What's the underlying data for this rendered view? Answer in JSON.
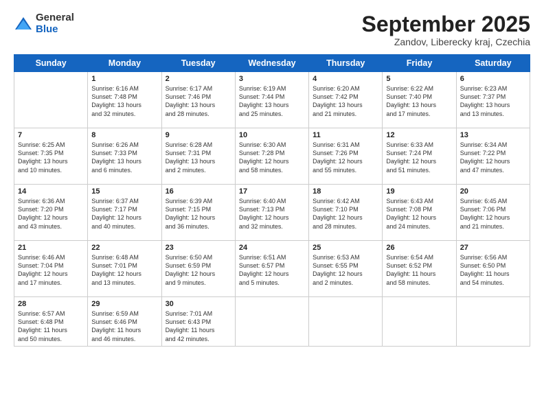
{
  "logo": {
    "general": "General",
    "blue": "Blue"
  },
  "header": {
    "month": "September 2025",
    "location": "Zandov, Liberecky kraj, Czechia"
  },
  "days_of_week": [
    "Sunday",
    "Monday",
    "Tuesday",
    "Wednesday",
    "Thursday",
    "Friday",
    "Saturday"
  ],
  "weeks": [
    [
      {
        "day": "",
        "info": ""
      },
      {
        "day": "1",
        "info": "Sunrise: 6:16 AM\nSunset: 7:48 PM\nDaylight: 13 hours\nand 32 minutes."
      },
      {
        "day": "2",
        "info": "Sunrise: 6:17 AM\nSunset: 7:46 PM\nDaylight: 13 hours\nand 28 minutes."
      },
      {
        "day": "3",
        "info": "Sunrise: 6:19 AM\nSunset: 7:44 PM\nDaylight: 13 hours\nand 25 minutes."
      },
      {
        "day": "4",
        "info": "Sunrise: 6:20 AM\nSunset: 7:42 PM\nDaylight: 13 hours\nand 21 minutes."
      },
      {
        "day": "5",
        "info": "Sunrise: 6:22 AM\nSunset: 7:40 PM\nDaylight: 13 hours\nand 17 minutes."
      },
      {
        "day": "6",
        "info": "Sunrise: 6:23 AM\nSunset: 7:37 PM\nDaylight: 13 hours\nand 13 minutes."
      }
    ],
    [
      {
        "day": "7",
        "info": "Sunrise: 6:25 AM\nSunset: 7:35 PM\nDaylight: 13 hours\nand 10 minutes."
      },
      {
        "day": "8",
        "info": "Sunrise: 6:26 AM\nSunset: 7:33 PM\nDaylight: 13 hours\nand 6 minutes."
      },
      {
        "day": "9",
        "info": "Sunrise: 6:28 AM\nSunset: 7:31 PM\nDaylight: 13 hours\nand 2 minutes."
      },
      {
        "day": "10",
        "info": "Sunrise: 6:30 AM\nSunset: 7:28 PM\nDaylight: 12 hours\nand 58 minutes."
      },
      {
        "day": "11",
        "info": "Sunrise: 6:31 AM\nSunset: 7:26 PM\nDaylight: 12 hours\nand 55 minutes."
      },
      {
        "day": "12",
        "info": "Sunrise: 6:33 AM\nSunset: 7:24 PM\nDaylight: 12 hours\nand 51 minutes."
      },
      {
        "day": "13",
        "info": "Sunrise: 6:34 AM\nSunset: 7:22 PM\nDaylight: 12 hours\nand 47 minutes."
      }
    ],
    [
      {
        "day": "14",
        "info": "Sunrise: 6:36 AM\nSunset: 7:20 PM\nDaylight: 12 hours\nand 43 minutes."
      },
      {
        "day": "15",
        "info": "Sunrise: 6:37 AM\nSunset: 7:17 PM\nDaylight: 12 hours\nand 40 minutes."
      },
      {
        "day": "16",
        "info": "Sunrise: 6:39 AM\nSunset: 7:15 PM\nDaylight: 12 hours\nand 36 minutes."
      },
      {
        "day": "17",
        "info": "Sunrise: 6:40 AM\nSunset: 7:13 PM\nDaylight: 12 hours\nand 32 minutes."
      },
      {
        "day": "18",
        "info": "Sunrise: 6:42 AM\nSunset: 7:10 PM\nDaylight: 12 hours\nand 28 minutes."
      },
      {
        "day": "19",
        "info": "Sunrise: 6:43 AM\nSunset: 7:08 PM\nDaylight: 12 hours\nand 24 minutes."
      },
      {
        "day": "20",
        "info": "Sunrise: 6:45 AM\nSunset: 7:06 PM\nDaylight: 12 hours\nand 21 minutes."
      }
    ],
    [
      {
        "day": "21",
        "info": "Sunrise: 6:46 AM\nSunset: 7:04 PM\nDaylight: 12 hours\nand 17 minutes."
      },
      {
        "day": "22",
        "info": "Sunrise: 6:48 AM\nSunset: 7:01 PM\nDaylight: 12 hours\nand 13 minutes."
      },
      {
        "day": "23",
        "info": "Sunrise: 6:50 AM\nSunset: 6:59 PM\nDaylight: 12 hours\nand 9 minutes."
      },
      {
        "day": "24",
        "info": "Sunrise: 6:51 AM\nSunset: 6:57 PM\nDaylight: 12 hours\nand 5 minutes."
      },
      {
        "day": "25",
        "info": "Sunrise: 6:53 AM\nSunset: 6:55 PM\nDaylight: 12 hours\nand 2 minutes."
      },
      {
        "day": "26",
        "info": "Sunrise: 6:54 AM\nSunset: 6:52 PM\nDaylight: 11 hours\nand 58 minutes."
      },
      {
        "day": "27",
        "info": "Sunrise: 6:56 AM\nSunset: 6:50 PM\nDaylight: 11 hours\nand 54 minutes."
      }
    ],
    [
      {
        "day": "28",
        "info": "Sunrise: 6:57 AM\nSunset: 6:48 PM\nDaylight: 11 hours\nand 50 minutes."
      },
      {
        "day": "29",
        "info": "Sunrise: 6:59 AM\nSunset: 6:46 PM\nDaylight: 11 hours\nand 46 minutes."
      },
      {
        "day": "30",
        "info": "Sunrise: 7:01 AM\nSunset: 6:43 PM\nDaylight: 11 hours\nand 42 minutes."
      },
      {
        "day": "",
        "info": ""
      },
      {
        "day": "",
        "info": ""
      },
      {
        "day": "",
        "info": ""
      },
      {
        "day": "",
        "info": ""
      }
    ]
  ]
}
